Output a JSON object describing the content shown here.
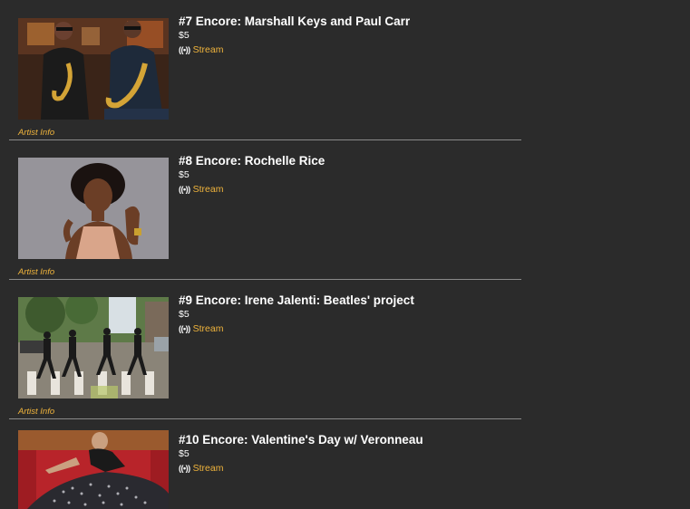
{
  "events": [
    {
      "title": "#7 Encore: Marshall Keys and Paul Carr",
      "price": "$5",
      "stream_icon": "((•))",
      "stream_label": "Stream",
      "artist_info_label": "Artist Info"
    },
    {
      "title": "#8 Encore: Rochelle Rice",
      "price": "$5",
      "stream_icon": "((•))",
      "stream_label": "Stream",
      "artist_info_label": "Artist Info"
    },
    {
      "title": "#9 Encore: Irene Jalenti: Beatles' project",
      "price": "$5",
      "stream_icon": "((•))",
      "stream_label": "Stream",
      "artist_info_label": "Artist Info"
    },
    {
      "title": "#10 Encore: Valentine's Day w/ Veronneau",
      "price": "$5",
      "stream_icon": "((•))",
      "stream_label": "Stream"
    }
  ],
  "colors": {
    "background": "#2b2b2b",
    "link_accent": "#f0b43c",
    "divider": "#8a8a8a",
    "title": "#ffffff"
  }
}
